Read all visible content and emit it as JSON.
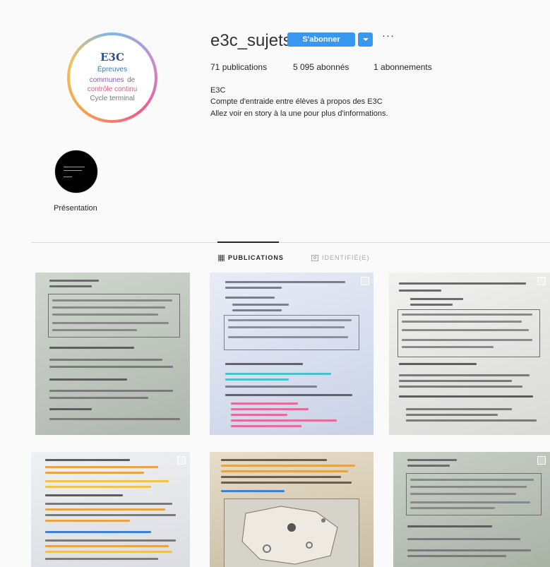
{
  "profile": {
    "username": "e3c_sujets",
    "follow_label": "S'abonner",
    "more_label": "···",
    "avatar_text": {
      "title": "E3C",
      "line1": "Épreuves",
      "line2_a": "communes",
      "line2_b": "de",
      "line3": "contrôle continu",
      "line4": "Cycle terminal"
    }
  },
  "stats": {
    "posts": "71",
    "posts_label": "publications",
    "followers": "5 095",
    "followers_label": "abonnés",
    "following": "1",
    "following_label": "abonnements"
  },
  "bio": {
    "name": "E3C",
    "line1": "Compte d'entraide entre élèves à propos des E3C",
    "line2": "Allez voir en story à la une pour plus d'informations."
  },
  "highlight": {
    "label": "Présentation"
  },
  "tabs": {
    "publications": "PUBLICATIONS",
    "tagged": "IDENTIFIÉ(E)"
  },
  "colors": {
    "accent": "#3897f0",
    "background": "#fafafa"
  }
}
